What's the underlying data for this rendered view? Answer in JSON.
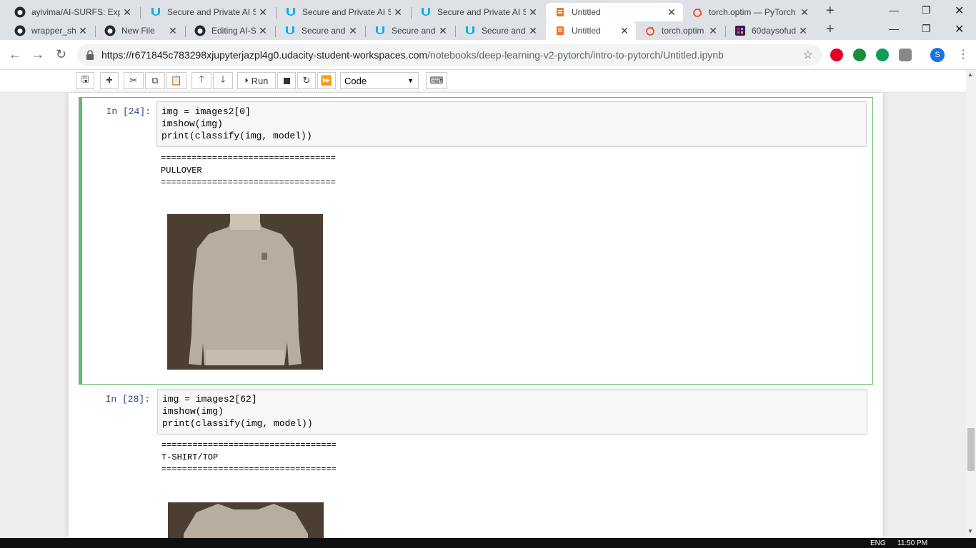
{
  "browser": {
    "row1_tabs": [
      {
        "label": "ayivima/AI-SURFS: Expl",
        "icon": "github-icon"
      },
      {
        "label": "Secure and Private AI S",
        "icon": "udacity-icon"
      },
      {
        "label": "Secure and Private AI S",
        "icon": "udacity-icon"
      },
      {
        "label": "Secure and Private AI S",
        "icon": "udacity-icon"
      },
      {
        "label": "Untitled",
        "icon": "jupyter-icon"
      },
      {
        "label": "torch.optim — PyTorch",
        "icon": "pytorch-icon"
      }
    ],
    "row2_tabs": [
      {
        "label": "wrapper_sh",
        "icon": "github-icon"
      },
      {
        "label": "New File",
        "icon": "github-icon"
      },
      {
        "label": "Editing AI-S",
        "icon": "github-icon"
      },
      {
        "label": "Secure and",
        "icon": "udacity-icon"
      },
      {
        "label": "Secure and",
        "icon": "udacity-icon"
      },
      {
        "label": "Secure and",
        "icon": "udacity-icon"
      },
      {
        "label": "Untitled",
        "icon": "jupyter-icon"
      },
      {
        "label": "torch.optim",
        "icon": "pytorch-icon"
      },
      {
        "label": "60daysofud",
        "icon": "slack-icon"
      }
    ],
    "url_host": "https://r671845c783298xjupyterjazpl4g0.udacity-student-workspaces.com",
    "url_path": "/notebooks/deep-learning-v2-pytorch/intro-to-pytorch/Untitled.ipynb",
    "profile_initial": "S"
  },
  "toolbar": {
    "run_label": "Run",
    "cell_type": "Code"
  },
  "cells": [
    {
      "prompt": "In [24]:",
      "line1": "img = images2[0]",
      "line2": "imshow(img)",
      "line3": "print(classify(img, model))",
      "out_rule1": "==================================",
      "out_label": "PULLOVER",
      "out_rule2": "=================================="
    },
    {
      "prompt": "In [28]:",
      "line1": "img = images2[62]",
      "line2": "imshow(img)",
      "line3": "print(classify(img, model))",
      "out_rule1": "==================================",
      "out_label": "T-SHIRT/TOP",
      "out_rule2": "=================================="
    }
  ],
  "taskbar": {
    "lang": "ENG",
    "time": "11:50 PM"
  },
  "colors": {
    "selected_cell": "#66bb6a",
    "prompt": "#303f9f",
    "image_bg": "#4a3f30"
  }
}
